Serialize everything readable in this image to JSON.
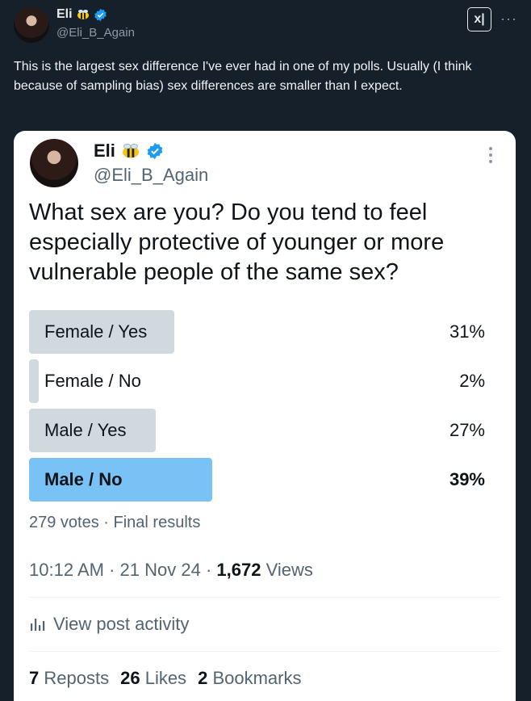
{
  "outer": {
    "name": "Eli",
    "handle": "@Eli_B_Again",
    "text": "This is the largest sex difference I've ever had in one of my polls. Usually (I think because of sampling bias) sex differences are smaller than I expect.",
    "logo_text": "x|",
    "more": "···"
  },
  "card": {
    "name": "Eli",
    "handle": "@Eli_B_Again",
    "question": "What sex are you? Do you tend to feel especially protective of younger or more vulnerable people of the same sex?",
    "poll": [
      {
        "label": "Female / Yes",
        "pct_text": "31%",
        "value": 31
      },
      {
        "label": "Female / No",
        "pct_text": "2%",
        "value": 2
      },
      {
        "label": "Male / Yes",
        "pct_text": "27%",
        "value": 27
      },
      {
        "label": "Male / No",
        "pct_text": "39%",
        "value": 39,
        "winner": true
      }
    ],
    "votes": "279 votes",
    "results": "Final results",
    "time": "10:12 AM",
    "date": "21 Nov 24",
    "views_count": "1,672",
    "views_label": "Views",
    "activity": "View post activity",
    "reposts_count": "7",
    "reposts_label": "Reposts",
    "likes_count": "26",
    "likes_label": "Likes",
    "bookmarks_count": "2",
    "bookmarks_label": "Bookmarks"
  },
  "colors": {
    "background": "#15202b",
    "poll_bar": "#cfd9de",
    "poll_winner": "#78c2f5",
    "verified": "#1d9bf0"
  }
}
